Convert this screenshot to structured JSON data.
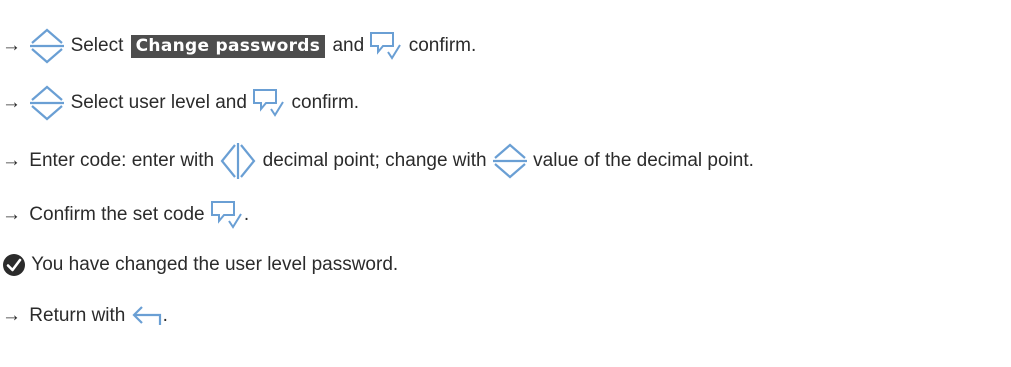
{
  "steps": [
    {
      "arrow": "→",
      "icon": "up-down-arrows-icon",
      "text_before": "Select",
      "highlight": "Change passwords",
      "text_mid": "and",
      "icon2": "confirm-icon",
      "text_after": "confirm."
    },
    {
      "arrow": "→",
      "icon": "up-down-arrows-icon",
      "text_before": "Select user level and",
      "icon2": "confirm-icon",
      "text_after": "confirm."
    },
    {
      "arrow": "→",
      "text_before": "Enter code: enter with",
      "icon": "left-right-arrows-icon",
      "text_mid": "decimal point; change with",
      "icon2": "up-down-arrows-icon",
      "text_after": "value of the decimal point."
    },
    {
      "arrow": "→",
      "text_before": "Confirm the set code",
      "icon": "confirm-icon",
      "text_after": "."
    },
    {
      "icon": "check-circle-icon",
      "text": "You have changed the user level password."
    },
    {
      "arrow": "→",
      "text_before": "Return with",
      "icon": "back-icon",
      "text_after": "."
    }
  ],
  "colors": {
    "icon_blue": "#6a9fd4",
    "text": "#2b2b2b",
    "highlight_bg": "#4d4d4d",
    "highlight_text": "#ffffff",
    "check_circle": "#2b2b2b"
  }
}
